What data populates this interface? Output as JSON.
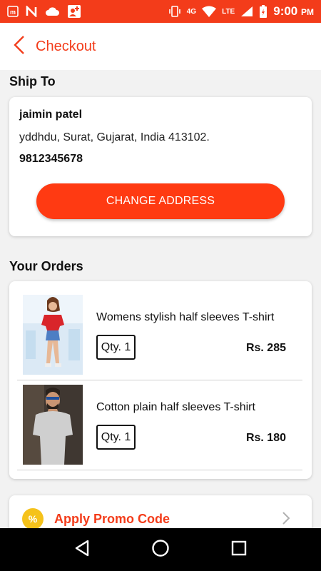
{
  "status_bar": {
    "network": "4G",
    "lte": "LTE",
    "time": "9:00",
    "ampm": "PM",
    "icons": [
      "m-app-icon",
      "n-app-icon",
      "cloud-icon",
      "add-user-icon",
      "vibrate-icon",
      "wifi-icon",
      "signal-icon",
      "battery-icon"
    ]
  },
  "app_bar": {
    "title": "Checkout",
    "back_icon": "chevron-left-icon"
  },
  "ship_to": {
    "section_title": "Ship To",
    "name": "jaimin patel",
    "address": "yddhdu, Surat, Gujarat, India 413102.",
    "phone": "9812345678",
    "change_button": "CHANGE ADDRESS"
  },
  "orders": {
    "section_title": "Your Orders",
    "items": [
      {
        "name": "Womens stylish half sleeves T-shirt",
        "qty": "Qty. 1",
        "price": "Rs. 285"
      },
      {
        "name": "Cotton plain half sleeves T-shirt",
        "qty": "Qty. 1",
        "price": "Rs. 180"
      }
    ]
  },
  "promo": {
    "icon_text": "%",
    "label": "Apply Promo Code"
  },
  "colors": {
    "accent": "#f33c1a",
    "button": "#ff3a12",
    "promo_icon": "#f5c21b"
  }
}
